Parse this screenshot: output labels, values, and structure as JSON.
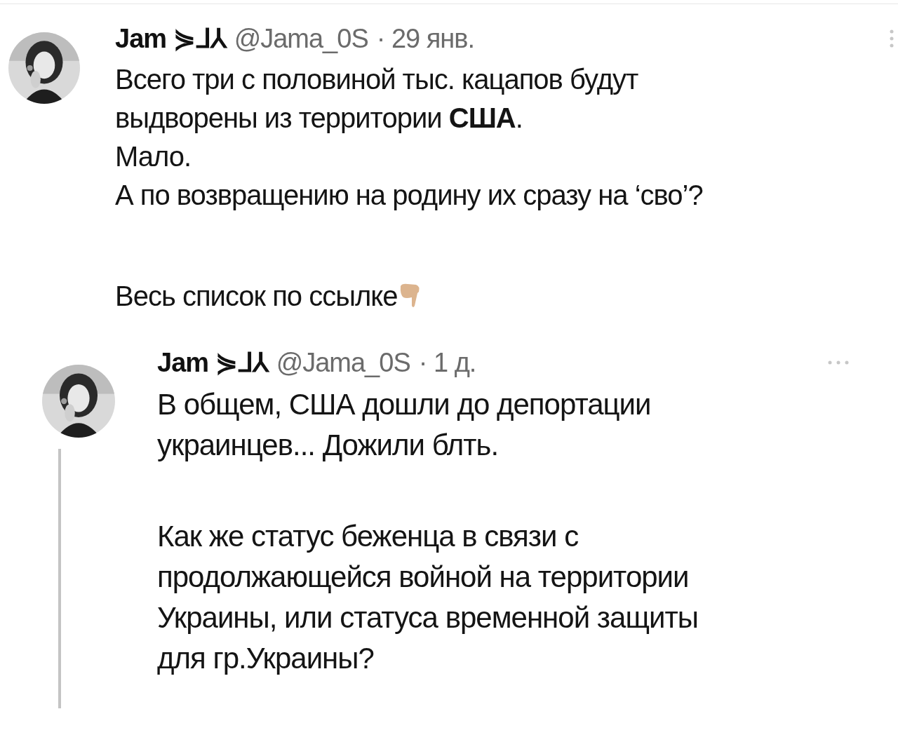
{
  "tweets": [
    {
      "name": "Jam ⋟ᒧ⅄",
      "handle": "@Jama_0S",
      "time": "· 29 янв.",
      "kind": "post",
      "blocks": [
        [
          "Всего три с половиной тыс. кацапов будут",
          "выдворены из территории **США**.",
          "Мало.",
          "А по возвращению на родину их сразу на ‘сво’?"
        ],
        [
          "Весь список по ссылке"
        ]
      ]
    },
    {
      "name": "Jam ⋟ᒧ⅄",
      "handle": "@Jama_0S",
      "time": "· 1 д.",
      "kind": "reply",
      "blocks": [
        [
          "В общем, США дошли до депортации",
          "украинцев... Дожили блть."
        ],
        [
          "Как же статус беженца в связи с",
          "продолжающейся войной на территории",
          "Украины, или статуса временной защиты",
          "для гр.Украины?"
        ]
      ]
    }
  ]
}
